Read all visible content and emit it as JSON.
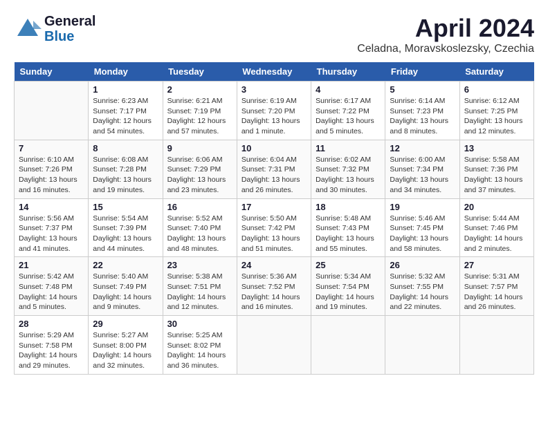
{
  "header": {
    "logo_general": "General",
    "logo_blue": "Blue",
    "month_year": "April 2024",
    "location": "Celadna, Moravskoslezsky, Czechia"
  },
  "calendar": {
    "days_of_week": [
      "Sunday",
      "Monday",
      "Tuesday",
      "Wednesday",
      "Thursday",
      "Friday",
      "Saturday"
    ],
    "weeks": [
      [
        {
          "day": "",
          "info": ""
        },
        {
          "day": "1",
          "info": "Sunrise: 6:23 AM\nSunset: 7:17 PM\nDaylight: 12 hours\nand 54 minutes."
        },
        {
          "day": "2",
          "info": "Sunrise: 6:21 AM\nSunset: 7:19 PM\nDaylight: 12 hours\nand 57 minutes."
        },
        {
          "day": "3",
          "info": "Sunrise: 6:19 AM\nSunset: 7:20 PM\nDaylight: 13 hours\nand 1 minute."
        },
        {
          "day": "4",
          "info": "Sunrise: 6:17 AM\nSunset: 7:22 PM\nDaylight: 13 hours\nand 5 minutes."
        },
        {
          "day": "5",
          "info": "Sunrise: 6:14 AM\nSunset: 7:23 PM\nDaylight: 13 hours\nand 8 minutes."
        },
        {
          "day": "6",
          "info": "Sunrise: 6:12 AM\nSunset: 7:25 PM\nDaylight: 13 hours\nand 12 minutes."
        }
      ],
      [
        {
          "day": "7",
          "info": "Sunrise: 6:10 AM\nSunset: 7:26 PM\nDaylight: 13 hours\nand 16 minutes."
        },
        {
          "day": "8",
          "info": "Sunrise: 6:08 AM\nSunset: 7:28 PM\nDaylight: 13 hours\nand 19 minutes."
        },
        {
          "day": "9",
          "info": "Sunrise: 6:06 AM\nSunset: 7:29 PM\nDaylight: 13 hours\nand 23 minutes."
        },
        {
          "day": "10",
          "info": "Sunrise: 6:04 AM\nSunset: 7:31 PM\nDaylight: 13 hours\nand 26 minutes."
        },
        {
          "day": "11",
          "info": "Sunrise: 6:02 AM\nSunset: 7:32 PM\nDaylight: 13 hours\nand 30 minutes."
        },
        {
          "day": "12",
          "info": "Sunrise: 6:00 AM\nSunset: 7:34 PM\nDaylight: 13 hours\nand 34 minutes."
        },
        {
          "day": "13",
          "info": "Sunrise: 5:58 AM\nSunset: 7:36 PM\nDaylight: 13 hours\nand 37 minutes."
        }
      ],
      [
        {
          "day": "14",
          "info": "Sunrise: 5:56 AM\nSunset: 7:37 PM\nDaylight: 13 hours\nand 41 minutes."
        },
        {
          "day": "15",
          "info": "Sunrise: 5:54 AM\nSunset: 7:39 PM\nDaylight: 13 hours\nand 44 minutes."
        },
        {
          "day": "16",
          "info": "Sunrise: 5:52 AM\nSunset: 7:40 PM\nDaylight: 13 hours\nand 48 minutes."
        },
        {
          "day": "17",
          "info": "Sunrise: 5:50 AM\nSunset: 7:42 PM\nDaylight: 13 hours\nand 51 minutes."
        },
        {
          "day": "18",
          "info": "Sunrise: 5:48 AM\nSunset: 7:43 PM\nDaylight: 13 hours\nand 55 minutes."
        },
        {
          "day": "19",
          "info": "Sunrise: 5:46 AM\nSunset: 7:45 PM\nDaylight: 13 hours\nand 58 minutes."
        },
        {
          "day": "20",
          "info": "Sunrise: 5:44 AM\nSunset: 7:46 PM\nDaylight: 14 hours\nand 2 minutes."
        }
      ],
      [
        {
          "day": "21",
          "info": "Sunrise: 5:42 AM\nSunset: 7:48 PM\nDaylight: 14 hours\nand 5 minutes."
        },
        {
          "day": "22",
          "info": "Sunrise: 5:40 AM\nSunset: 7:49 PM\nDaylight: 14 hours\nand 9 minutes."
        },
        {
          "day": "23",
          "info": "Sunrise: 5:38 AM\nSunset: 7:51 PM\nDaylight: 14 hours\nand 12 minutes."
        },
        {
          "day": "24",
          "info": "Sunrise: 5:36 AM\nSunset: 7:52 PM\nDaylight: 14 hours\nand 16 minutes."
        },
        {
          "day": "25",
          "info": "Sunrise: 5:34 AM\nSunset: 7:54 PM\nDaylight: 14 hours\nand 19 minutes."
        },
        {
          "day": "26",
          "info": "Sunrise: 5:32 AM\nSunset: 7:55 PM\nDaylight: 14 hours\nand 22 minutes."
        },
        {
          "day": "27",
          "info": "Sunrise: 5:31 AM\nSunset: 7:57 PM\nDaylight: 14 hours\nand 26 minutes."
        }
      ],
      [
        {
          "day": "28",
          "info": "Sunrise: 5:29 AM\nSunset: 7:58 PM\nDaylight: 14 hours\nand 29 minutes."
        },
        {
          "day": "29",
          "info": "Sunrise: 5:27 AM\nSunset: 8:00 PM\nDaylight: 14 hours\nand 32 minutes."
        },
        {
          "day": "30",
          "info": "Sunrise: 5:25 AM\nSunset: 8:02 PM\nDaylight: 14 hours\nand 36 minutes."
        },
        {
          "day": "",
          "info": ""
        },
        {
          "day": "",
          "info": ""
        },
        {
          "day": "",
          "info": ""
        },
        {
          "day": "",
          "info": ""
        }
      ]
    ]
  }
}
